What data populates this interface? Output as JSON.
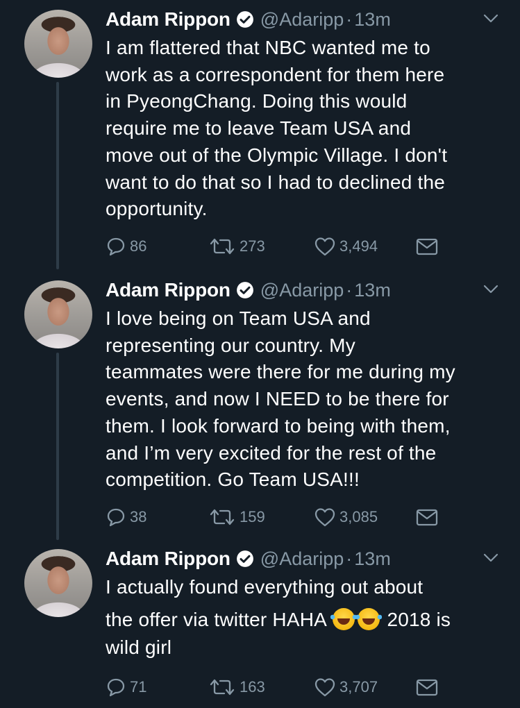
{
  "tweets": [
    {
      "name": "Adam Rippon",
      "handle": "@Adaripp",
      "dot": "·",
      "time": "13m",
      "text": "I am flattered that NBC wanted me to\nwork as a correspondent for them here\nin PyeongChang. Doing this would\nrequire me to leave Team USA and\nmove out of the Olympic Village.  I don't\nwant to do that so I had to declined the\nopportunity.",
      "replies": "86",
      "retweets": "273",
      "likes": "3,494"
    },
    {
      "name": "Adam Rippon",
      "handle": "@Adaripp",
      "dot": "·",
      "time": "13m",
      "text": "I love being on Team USA and\nrepresenting our country.  My\nteammates were there for me during my\nevents, and now I NEED to be there for\nthem. I look forward to being with them,\nand I’m very excited for the rest of the\ncompetition. Go Team USA!!!",
      "replies": "38",
      "retweets": "159",
      "likes": "3,085"
    },
    {
      "name": "Adam Rippon",
      "handle": "@Adaripp",
      "dot": "·",
      "time": "13m",
      "text_line1": "I actually found everything out about",
      "text_line2_a": "the offer via twitter HAHA ",
      "text_line2_b": " 2018 is",
      "text_line3": "wild girl",
      "emoji": "face-with-tears-of-joy-emoji",
      "replies": "71",
      "retweets": "163",
      "likes": "3,707"
    }
  ],
  "icons": {
    "verified": "verified-badge-icon",
    "menu": "chevron-down-icon",
    "reply": "reply-icon",
    "retweet": "retweet-icon",
    "like": "heart-icon",
    "dm": "envelope-icon"
  },
  "colors": {
    "background": "#141d26",
    "text": "#ffffff",
    "secondary": "#8899a6",
    "thread_line": "#2e3c48"
  }
}
